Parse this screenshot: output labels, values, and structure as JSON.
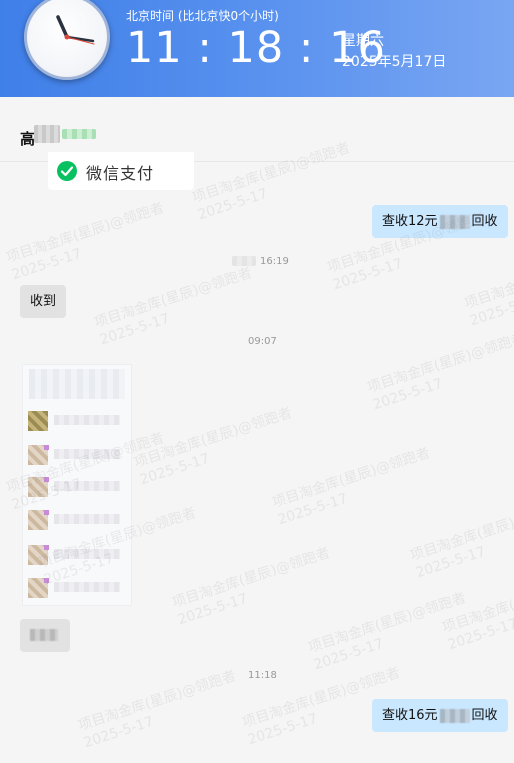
{
  "clock": {
    "timezone_label": "北京时间 (比北京快0个小时)",
    "time": "11 : 18 : 16",
    "weekday": "星期六",
    "date": "2025年5月17日"
  },
  "chat": {
    "contact_name": "高"
  },
  "payment_card": {
    "label": "微信支付",
    "icon": "wechat-pay-check-icon"
  },
  "messages": [
    {
      "type": "sent",
      "prefix": "查收12元",
      "suffix": "回收"
    },
    {
      "type": "timestamp",
      "text": "16:19"
    },
    {
      "type": "received",
      "text": "收到"
    },
    {
      "type": "timestamp",
      "text": "09:07"
    },
    {
      "type": "image"
    },
    {
      "type": "received-blurred"
    },
    {
      "type": "timestamp",
      "text": "11:18"
    },
    {
      "type": "sent",
      "prefix": "查收16元",
      "suffix": "回收"
    }
  ],
  "watermark": {
    "line1": "项目淘金库(星辰)@领跑者",
    "line2": "2025-5-17"
  },
  "colors": {
    "clock_bar": "#4a86ea",
    "sent_bubble": "#c9e7ff",
    "received_bubble": "#e2e2e2",
    "wechat_green": "#07c160"
  }
}
